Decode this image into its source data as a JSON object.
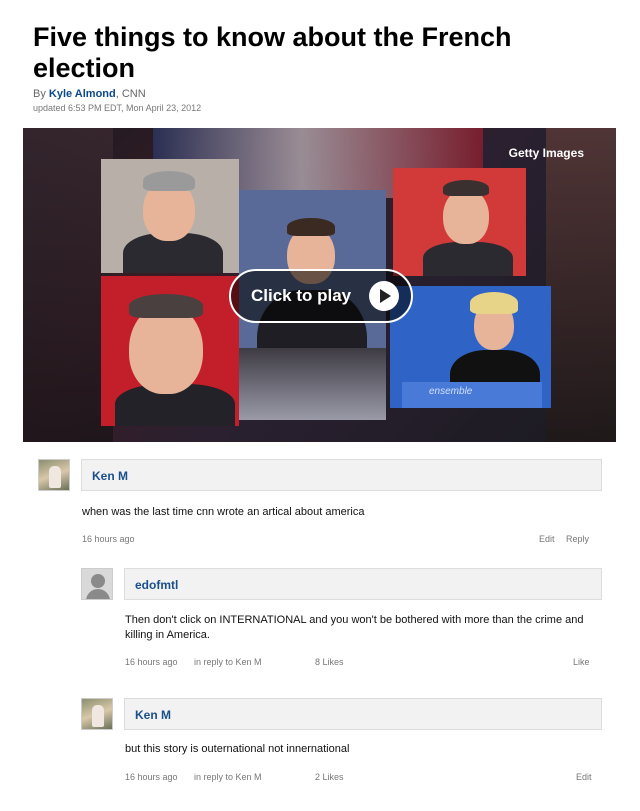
{
  "article": {
    "headline": "Five things to know about the French election",
    "byline_prefix": "By",
    "author": "Kyle Almond",
    "source": ", CNN",
    "updated": "updated 6:53 PM EDT, Mon April 23, 2012"
  },
  "video": {
    "credit": "Getty Images",
    "play_label": "Click to play",
    "podium_text": "ensemble"
  },
  "comments": [
    {
      "author": "Ken M",
      "text": "when was the last time cnn wrote an artical about america",
      "time": "16 hours ago",
      "edit_label": "Edit",
      "reply_label": "Reply"
    },
    {
      "author": "edofmtl",
      "text": "Then don't click on INTERNATIONAL and you won't be bothered with more than the crime and killing in America.",
      "time": "16 hours ago",
      "in_reply": "in reply to Ken M",
      "likes": "8 Likes",
      "like_label": "Like"
    },
    {
      "author": "Ken M",
      "text": "but this story is outernational not innernational",
      "time": "16 hours ago",
      "in_reply": "in reply to Ken M",
      "likes": "2 Likes",
      "edit_label": "Edit"
    }
  ]
}
